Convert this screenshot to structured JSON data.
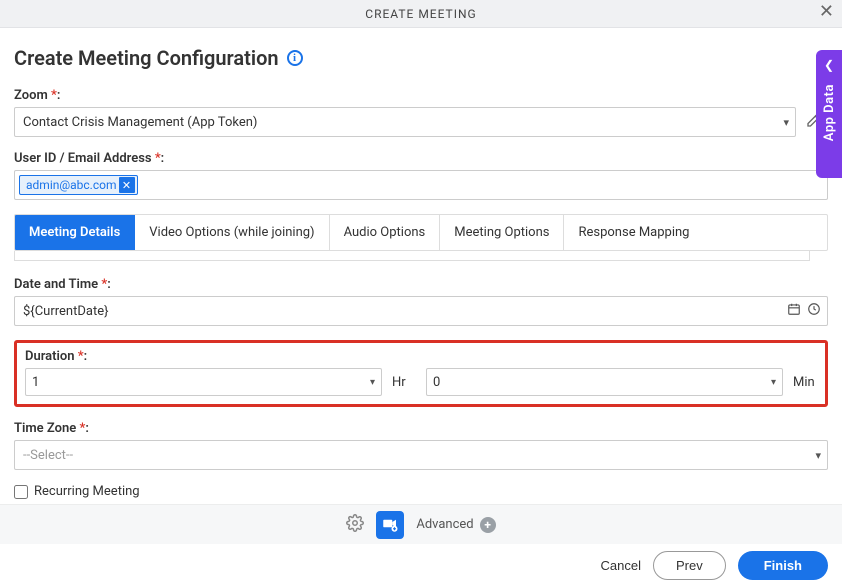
{
  "header": {
    "title": "CREATE MEETING"
  },
  "sidePanel": {
    "label": "App Data"
  },
  "page": {
    "title": "Create Meeting Configuration"
  },
  "zoom": {
    "label": "Zoom",
    "value": "Contact Crisis Management (App Token)"
  },
  "userId": {
    "label": "User ID / Email Address",
    "tag": "admin@abc.com"
  },
  "tabs": [
    "Meeting Details",
    "Video Options (while joining)",
    "Audio Options",
    "Meeting Options",
    "Response Mapping"
  ],
  "dateTime": {
    "label": "Date and Time",
    "value": "${CurrentDate}"
  },
  "duration": {
    "label": "Duration",
    "hours": "1",
    "hrUnit": "Hr",
    "minutes": "0",
    "minUnit": "Min"
  },
  "timeZone": {
    "label": "Time Zone",
    "placeholder": "--Select--"
  },
  "recurring": {
    "label": "Recurring Meeting"
  },
  "footer": {
    "advanced": "Advanced",
    "cancel": "Cancel",
    "prev": "Prev",
    "finish": "Finish"
  }
}
